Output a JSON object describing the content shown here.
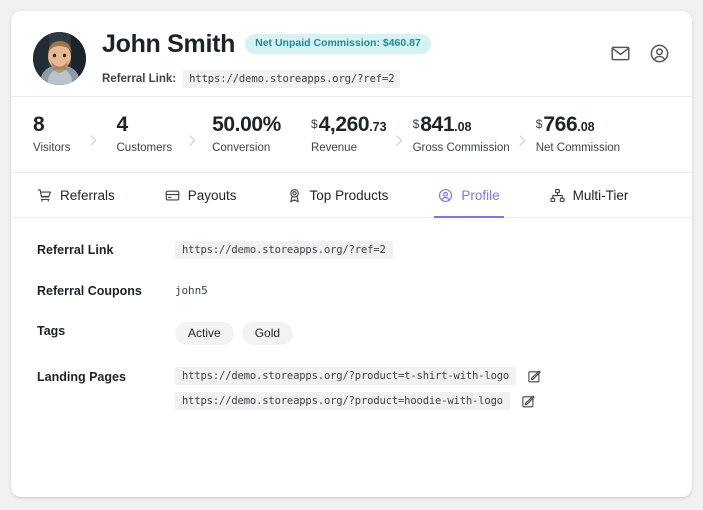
{
  "colors": {
    "accent": "#7b76f1",
    "badge_bg": "#d6f3f4",
    "badge_text": "#1a8c9b",
    "page_bg": "#f0f0f1",
    "card_bg": "#ffffff",
    "text": "#1d2327"
  },
  "header": {
    "avatar_icon": "user-photo-avatar",
    "name": "John Smith",
    "commission_badge": "Net Unpaid Commission: $460.87",
    "referral_label": "Referral Link:",
    "referral_link": "https://demo.storeapps.org/?ref=2",
    "actions": [
      {
        "icon": "envelope-icon",
        "name": "message-button"
      },
      {
        "icon": "user-circle-icon",
        "name": "account-button"
      }
    ]
  },
  "stats": [
    {
      "value": "8",
      "currency": "",
      "decimals": "",
      "label": "Visitors"
    },
    {
      "value": "4",
      "currency": "",
      "decimals": "",
      "label": "Customers"
    },
    {
      "value": "50.00%",
      "currency": "",
      "decimals": "",
      "label": "Conversion"
    },
    {
      "value": "4,260",
      "currency": "$",
      "decimals": ".73",
      "label": "Revenue"
    },
    {
      "value": "841",
      "currency": "$",
      "decimals": ".08",
      "label": "Gross Commission"
    },
    {
      "value": "766",
      "currency": "$",
      "decimals": ".08",
      "label": "Net Commission"
    }
  ],
  "stat_separator": "chevron-right-icon",
  "tabs": [
    {
      "label": "Referrals",
      "icon": "shopping-cart-icon",
      "active": false
    },
    {
      "label": "Payouts",
      "icon": "credit-card-icon",
      "active": false
    },
    {
      "label": "Top Products",
      "icon": "award-medal-icon",
      "active": false
    },
    {
      "label": "Profile",
      "icon": "user-circle-icon",
      "active": true
    },
    {
      "label": "Multi-Tier",
      "icon": "sitemap-icon",
      "active": false
    }
  ],
  "profile": {
    "referral_link": {
      "label": "Referral Link",
      "value": "https://demo.storeapps.org/?ref=2"
    },
    "referral_coupons": {
      "label": "Referral Coupons",
      "value": "john5"
    },
    "tags": {
      "label": "Tags",
      "values": [
        "Active",
        "Gold"
      ]
    },
    "landing_pages": {
      "label": "Landing Pages",
      "items": [
        {
          "url": "https://demo.storeapps.org/?product=t-shirt-with-logo",
          "edit_icon": "edit-pencil-icon"
        },
        {
          "url": "https://demo.storeapps.org/?product=hoodie-with-logo",
          "edit_icon": "edit-pencil-icon"
        }
      ]
    }
  }
}
